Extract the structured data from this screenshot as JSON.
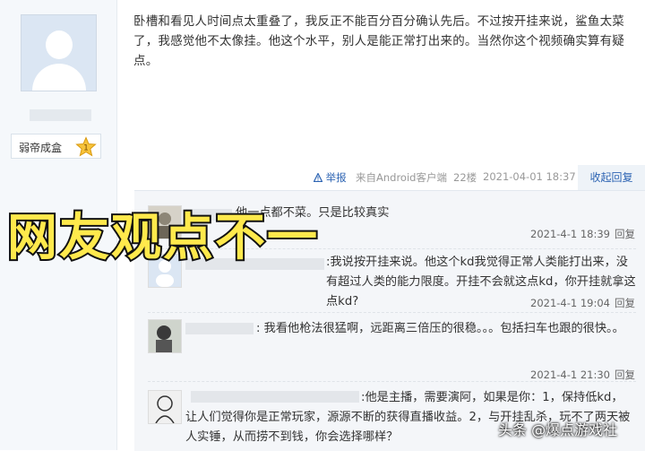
{
  "user": {
    "rank_label": "弱帝成盒",
    "rank_level": "1"
  },
  "post": {
    "text": "卧槽和看见人时间点太重叠了，我反正不能百分百分确认先后。不过按开挂来说，鲨鱼太菜了，我感觉他不太像挂。他这个水平，别人是能正常打出来的。当然你这个视频确实算有疑点。",
    "report_label": "举报",
    "source": "来自Android客户端",
    "floor": "22楼",
    "date": "2021-04-01 18:37",
    "collapse_label": "收起回复"
  },
  "replies": [
    {
      "text": "他一点都不菜。只是比较真实",
      "time": "2021-4-1 18:39",
      "reply_label": "回复"
    },
    {
      "text": ":我说按开挂来说。他这个kd我觉得正常人类能打出来，没有超过人类的能力限度。开挂不会就这点kd，你开挂就拿这点kd?",
      "time": "2021-4-1 19:04",
      "reply_label": "回复"
    },
    {
      "text": ": 我看他枪法很猛啊，远距离三倍压的很稳。。。包括扫车也跟的很快。。",
      "time": "2021-4-1 21:30",
      "reply_label": "回复"
    },
    {
      "text": ":他是主播，需要演阿，如果是你：1，保持低kd，让人们觉得你是正常玩家，源源不断的获得直播收益。2，与开挂乱杀，玩不了两天被人实锤，从而捞不到钱，你会选择哪样？",
      "time": "",
      "reply_label": ""
    }
  ],
  "overlay": {
    "title": "网友观点不一"
  },
  "watermark": "头条 @爆点游戏社",
  "colors": {
    "link": "#2d64b3",
    "overlay_fill": "#ffe94c"
  }
}
